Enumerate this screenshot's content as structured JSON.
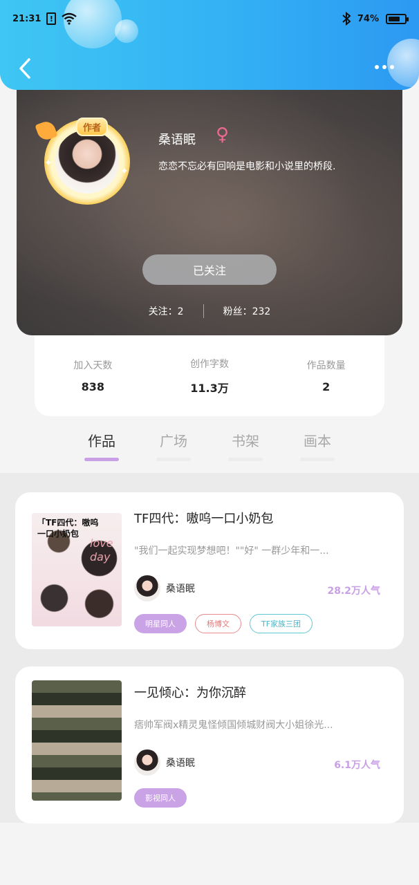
{
  "status_bar": {
    "time": "21:31",
    "notification": "!",
    "battery_text": "74%",
    "battery_level": 0.74
  },
  "header": {
    "back_icon": "chevron-left-icon",
    "more_icon": "more-horizontal-icon"
  },
  "profile": {
    "badge": "作者",
    "name": "桑语眠",
    "gender_symbol": "♀",
    "bio": "恋恋不忘必有回响是电影和小说里的桥段.",
    "follow_button": "已关注",
    "following": "关注：2",
    "followers": "粉丝：232"
  },
  "stats": [
    {
      "label": "加入天数",
      "value": "838"
    },
    {
      "label": "创作字数",
      "value": "11.3万"
    },
    {
      "label": "作品数量",
      "value": "2"
    }
  ],
  "tabs": [
    {
      "label": "作品",
      "active": true
    },
    {
      "label": "广场",
      "active": false
    },
    {
      "label": "书架",
      "active": false
    },
    {
      "label": "画本",
      "active": false
    }
  ],
  "works": [
    {
      "cover_text": "「TF四代：嗷呜一口小奶包",
      "cover_text_2": "love day",
      "title": "TF四代：嗷呜一口小奶包",
      "description": "\"我们一起实现梦想吧！\"\"好\" 一群少年和一...",
      "author": "桑语眠",
      "popularity": "28.2万人气",
      "tags": [
        "明星同人",
        "杨博文",
        "TF家族三团"
      ]
    },
    {
      "title": "一见倾心：为你沉醉",
      "description": "痞帅军阀x精灵鬼怪倾国倾城财阀大小姐徐光...",
      "author": "桑语眠",
      "popularity": "6.1万人气",
      "tags": [
        "影视同人"
      ]
    }
  ],
  "colors": {
    "header_start": "#3fc6f3",
    "header_end": "#2c99f2",
    "accent_purple": "#c9a0e6",
    "gender_pink": "#ec6b8d"
  }
}
